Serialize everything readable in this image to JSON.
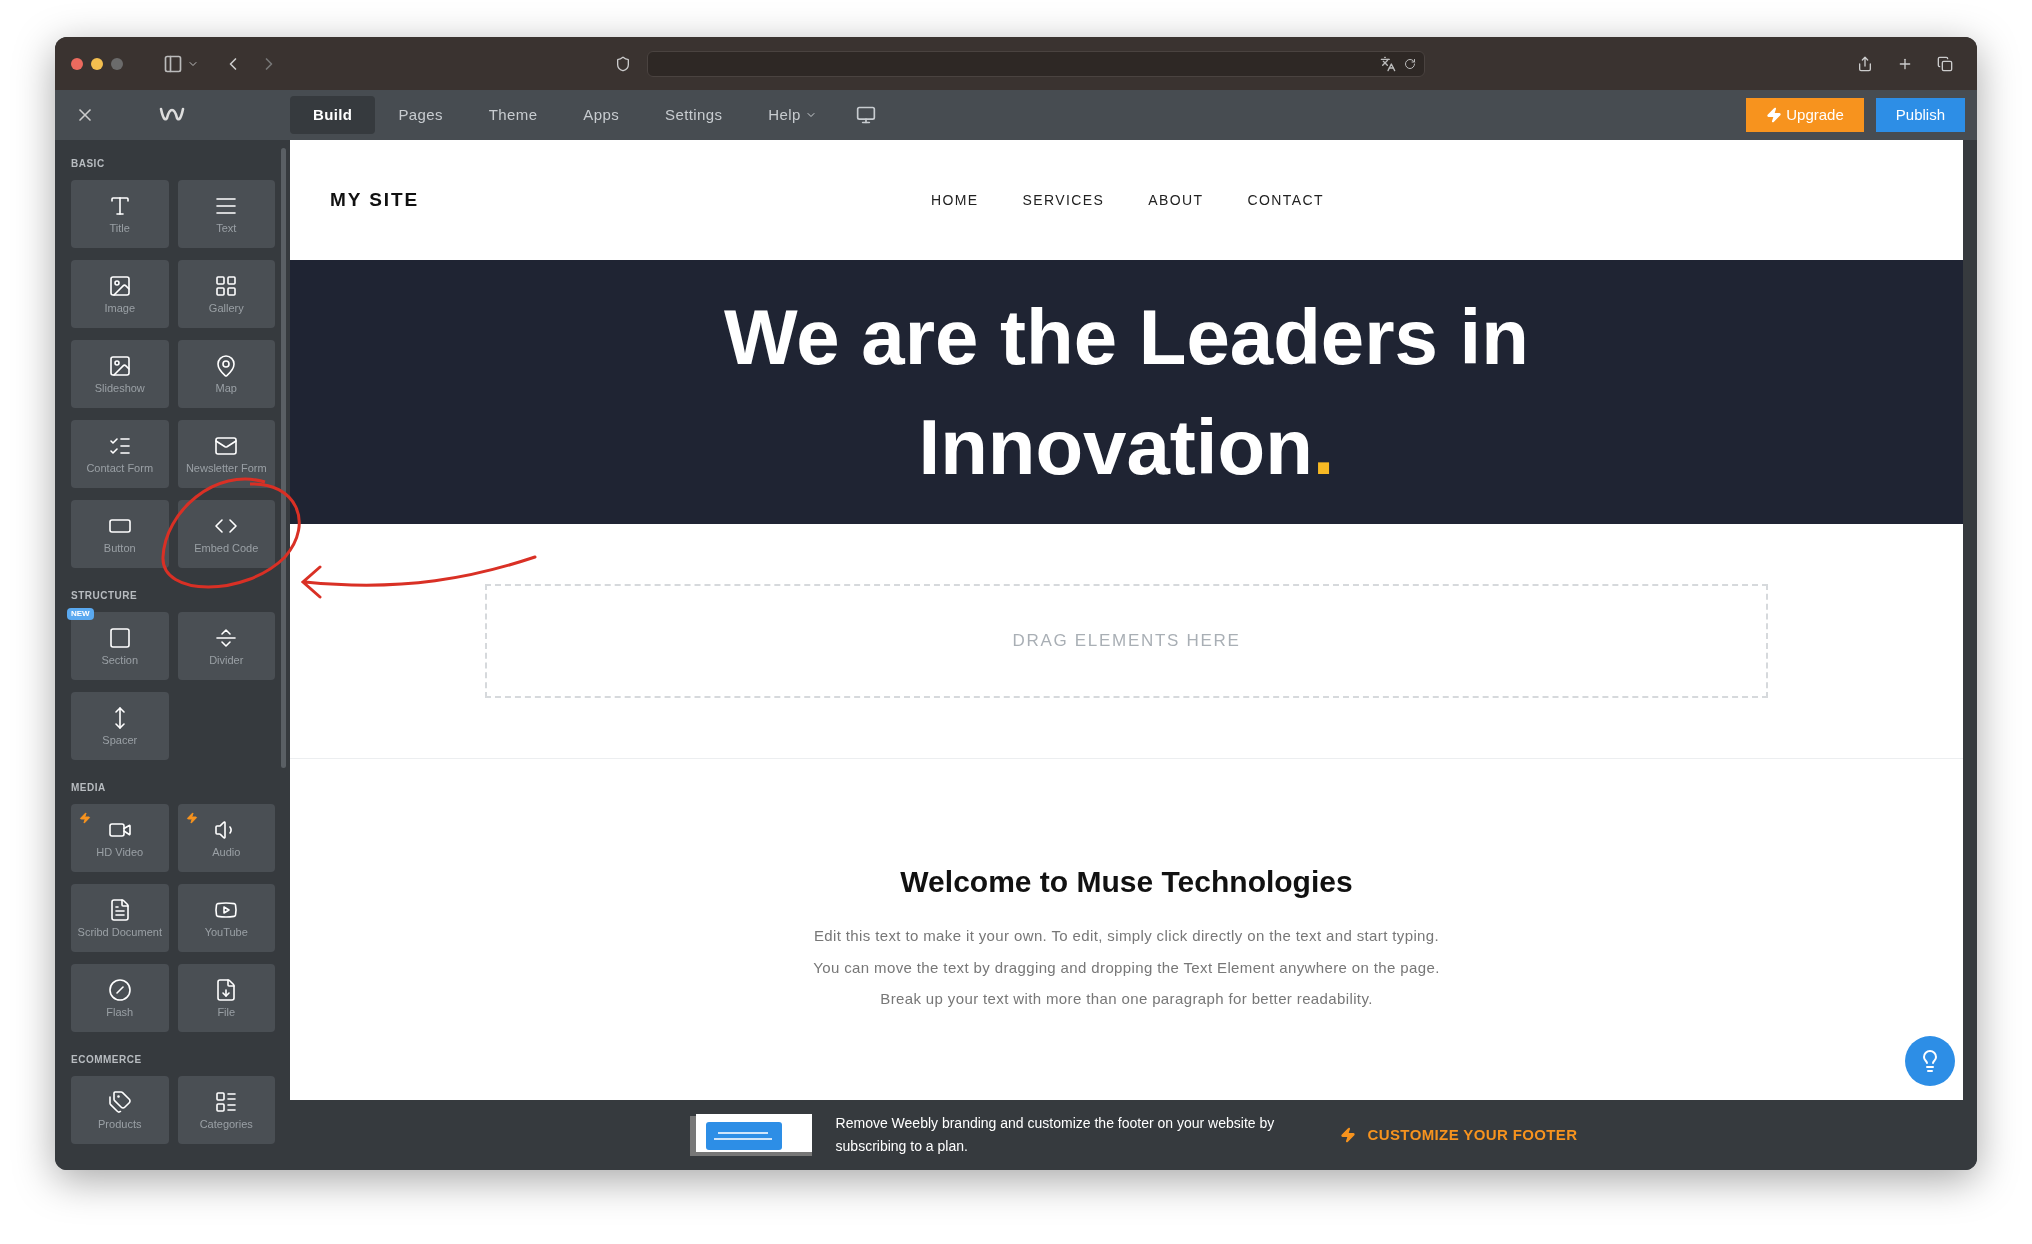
{
  "editor_toolbar": {
    "tabs": [
      {
        "label": "Build",
        "selected": true
      },
      {
        "label": "Pages",
        "selected": false
      },
      {
        "label": "Theme",
        "selected": false
      },
      {
        "label": "Apps",
        "selected": false
      },
      {
        "label": "Settings",
        "selected": false
      },
      {
        "label": "Help",
        "selected": false,
        "dropdown": true
      }
    ],
    "upgrade_button": "Upgrade",
    "publish_button": "Publish"
  },
  "sidebar": {
    "sections": [
      {
        "title": "BASIC",
        "items": [
          {
            "label": "Title",
            "premium": false
          },
          {
            "label": "Text",
            "premium": false
          },
          {
            "label": "Image",
            "premium": false
          },
          {
            "label": "Gallery",
            "premium": false
          },
          {
            "label": "Slideshow",
            "premium": false
          },
          {
            "label": "Map",
            "premium": false
          },
          {
            "label": "Contact Form",
            "premium": false
          },
          {
            "label": "Newsletter Form",
            "premium": false
          },
          {
            "label": "Button",
            "premium": false
          },
          {
            "label": "Embed Code",
            "premium": false
          }
        ]
      },
      {
        "title": "STRUCTURE",
        "items": [
          {
            "label": "Section",
            "premium": false,
            "badge": "NEW"
          },
          {
            "label": "Divider",
            "premium": false
          },
          {
            "label": "Spacer",
            "premium": false
          }
        ]
      },
      {
        "title": "MEDIA",
        "items": [
          {
            "label": "HD Video",
            "premium": true
          },
          {
            "label": "Audio",
            "premium": true
          },
          {
            "label": "Scribd Document",
            "premium": false
          },
          {
            "label": "YouTube",
            "premium": false
          },
          {
            "label": "Flash",
            "premium": false
          },
          {
            "label": "File",
            "premium": false
          }
        ]
      },
      {
        "title": "ECOMMERCE",
        "items": [
          {
            "label": "Products",
            "premium": false
          },
          {
            "label": "Categories",
            "premium": false
          }
        ]
      }
    ]
  },
  "site": {
    "logo": "MY SITE",
    "nav": [
      "HOME",
      "SERVICES",
      "ABOUT",
      "CONTACT"
    ],
    "hero": {
      "lines": [
        "We are the Leaders  in",
        "Innovation"
      ],
      "accent": "."
    },
    "drop_zone": "DRAG ELEMENTS HERE",
    "welcome": {
      "title": "Welcome to Muse Technologies",
      "paragraph": [
        "Edit this text to make it your own. To edit, simply click directly on the text and start typing.",
        "You can move the text by dragging and dropping the Text Element anywhere on the page.",
        "Break up your text with more than one paragraph for better readability."
      ]
    }
  },
  "footer_banner": {
    "message": "Remove Weebly branding and customize the footer on your website by subscribing to a plan.",
    "link": "CUSTOMIZE YOUR FOOTER"
  }
}
